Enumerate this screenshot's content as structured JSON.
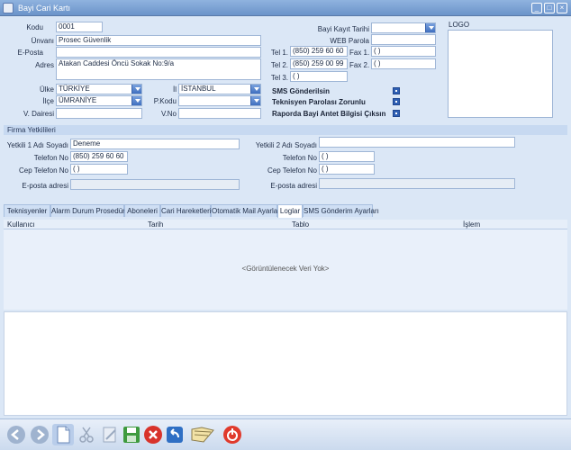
{
  "window": {
    "title": "Bayi Cari Kartı"
  },
  "form": {
    "kodu_label": "Kodu",
    "kodu_value": "0001",
    "unvani_label": "Ünvanı",
    "unvani_value": "Prosec Güvenlik",
    "eposta_label": "E-Posta",
    "eposta_value": "",
    "adres_label": "Adres",
    "adres_value": "Atakan Caddesi Öncü Sokak No:9/a",
    "ulke_label": "Ülke",
    "ulke_value": "TÜRKİYE",
    "ilce_label": "İlçe",
    "ilce_value": "ÜMRANİYE",
    "vdairesi_label": "V. Dairesi",
    "vdairesi_value": "",
    "il_label": "İl",
    "il_value": "İSTANBUL",
    "pkodu_label": "P.Kodu",
    "pkodu_value": "",
    "vno_label": "V.No",
    "vno_value": "",
    "kayit_tarihi_label": "Bayi Kayıt Tarihi",
    "kayit_tarihi_value": "",
    "web_parola_label": "WEB Parola",
    "web_parola_value": "",
    "tel1_label": "Tel 1.",
    "tel1_value": "(850) 259 60 60",
    "tel2_label": "Tel 2.",
    "tel2_value": "(850) 259 00 99",
    "tel3_label": "Tel 3.",
    "tel3_value": "(  )",
    "fax1_label": "Fax 1.",
    "fax1_value": "(  )",
    "fax2_label": "Fax 2.",
    "fax2_value": "(  )",
    "logo_label": "LOGO"
  },
  "options": {
    "sms": "SMS Gönderilsin",
    "teknisyen": "Teknisyen Parolası Zorunlu",
    "rapor": "Raporda Bayi Antet Bilgisi Çıksın"
  },
  "firma": {
    "header": "Firma Yetkilileri",
    "y1_name_label": "Yetkili 1 Adı Soyadı",
    "y1_name_value": "Deneme",
    "y1_tel_label": "Telefon No",
    "y1_tel_value": "(850) 259 60 60",
    "y1_cep_label": "Cep Telefon No",
    "y1_cep_value": "(  )",
    "y1_eposta_label": "E-posta adresi",
    "y1_eposta_value": "",
    "y2_name_label": "Yetkili 2 Adı Soyadı",
    "y2_name_value": "",
    "y2_tel_label": "Telefon No",
    "y2_tel_value": "(  )",
    "y2_cep_label": "Cep Telefon No",
    "y2_cep_value": "(  )",
    "y2_eposta_label": "E-posta adresi",
    "y2_eposta_value": ""
  },
  "tabs": [
    {
      "label": "Teknisyenler"
    },
    {
      "label": "Alarm Durum Prosedürü"
    },
    {
      "label": "Aboneleri"
    },
    {
      "label": "Cari Hareketleri"
    },
    {
      "label": "Otomatik Mail Ayarları"
    },
    {
      "label": "Loglar"
    },
    {
      "label": "SMS Gönderim Ayarları"
    }
  ],
  "grid": {
    "columns": [
      "Kullanıcı",
      "Tarih",
      "Tablo",
      "İşlem"
    ],
    "empty": "<Görüntülenecek Veri Yok>"
  },
  "colors": {
    "accent": "#3f6fbf",
    "titlebar": "#7da3d6"
  }
}
